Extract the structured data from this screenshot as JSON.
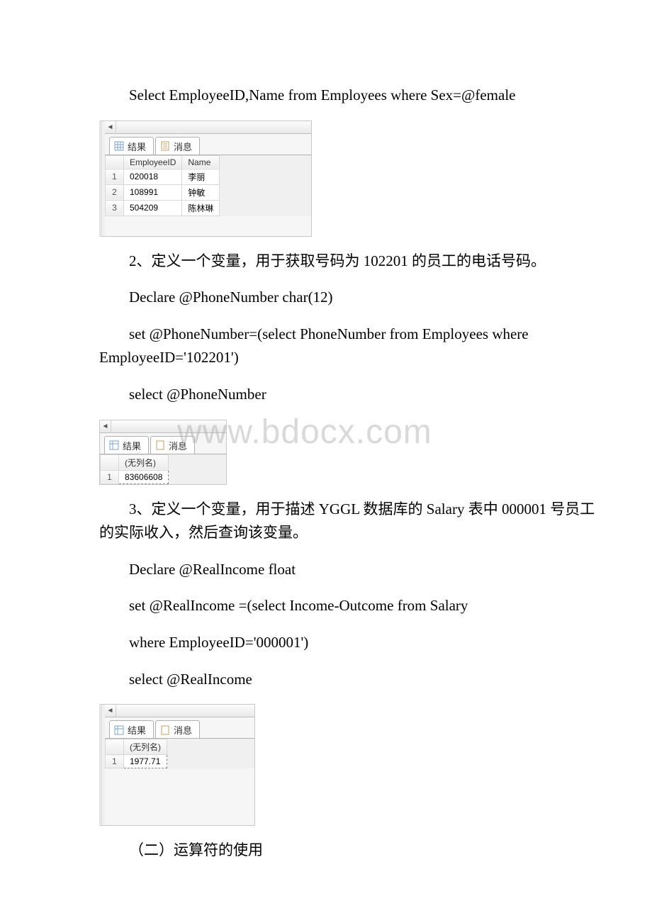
{
  "section1": {
    "sql": "Select EmployeeID,Name from Employees where Sex=@female",
    "tabs": {
      "results": "结果",
      "messages": "消息"
    },
    "table": {
      "headers": [
        "EmployeeID",
        "Name"
      ],
      "rows": [
        {
          "n": "1",
          "id": "020018",
          "name": "李丽"
        },
        {
          "n": "2",
          "id": "108991",
          "name": "钟敏"
        },
        {
          "n": "3",
          "id": "504209",
          "name": "陈林琳"
        }
      ]
    }
  },
  "section2": {
    "heading": "2、定义一个变量，用于获取号码为 102201 的员工的电话号码。",
    "line1": "Declare @PhoneNumber char(12)",
    "line2": "set @PhoneNumber=(select PhoneNumber from Employees where EmployeeID='102201')",
    "line3": "select @PhoneNumber",
    "tabs": {
      "results": "结果",
      "messages": "消息"
    },
    "table": {
      "header": "(无列名)",
      "rows": [
        {
          "n": "1",
          "v": "83606608"
        }
      ]
    },
    "watermark": "www.bdocx.com"
  },
  "section3": {
    "heading": "3、定义一个变量，用于描述 YGGL 数据库的 Salary 表中 000001 号员工的实际收入，然后查询该变量。",
    "line1": "Declare @RealIncome float",
    "line2": "set @RealIncome =(select Income-Outcome from Salary",
    "line3": "where EmployeeID='000001')",
    "line4": "select @RealIncome",
    "tabs": {
      "results": "结果",
      "messages": "消息"
    },
    "table": {
      "header": "(无列名)",
      "rows": [
        {
          "n": "1",
          "v": "1977.71"
        }
      ]
    }
  },
  "footer": "（二）运算符的使用"
}
